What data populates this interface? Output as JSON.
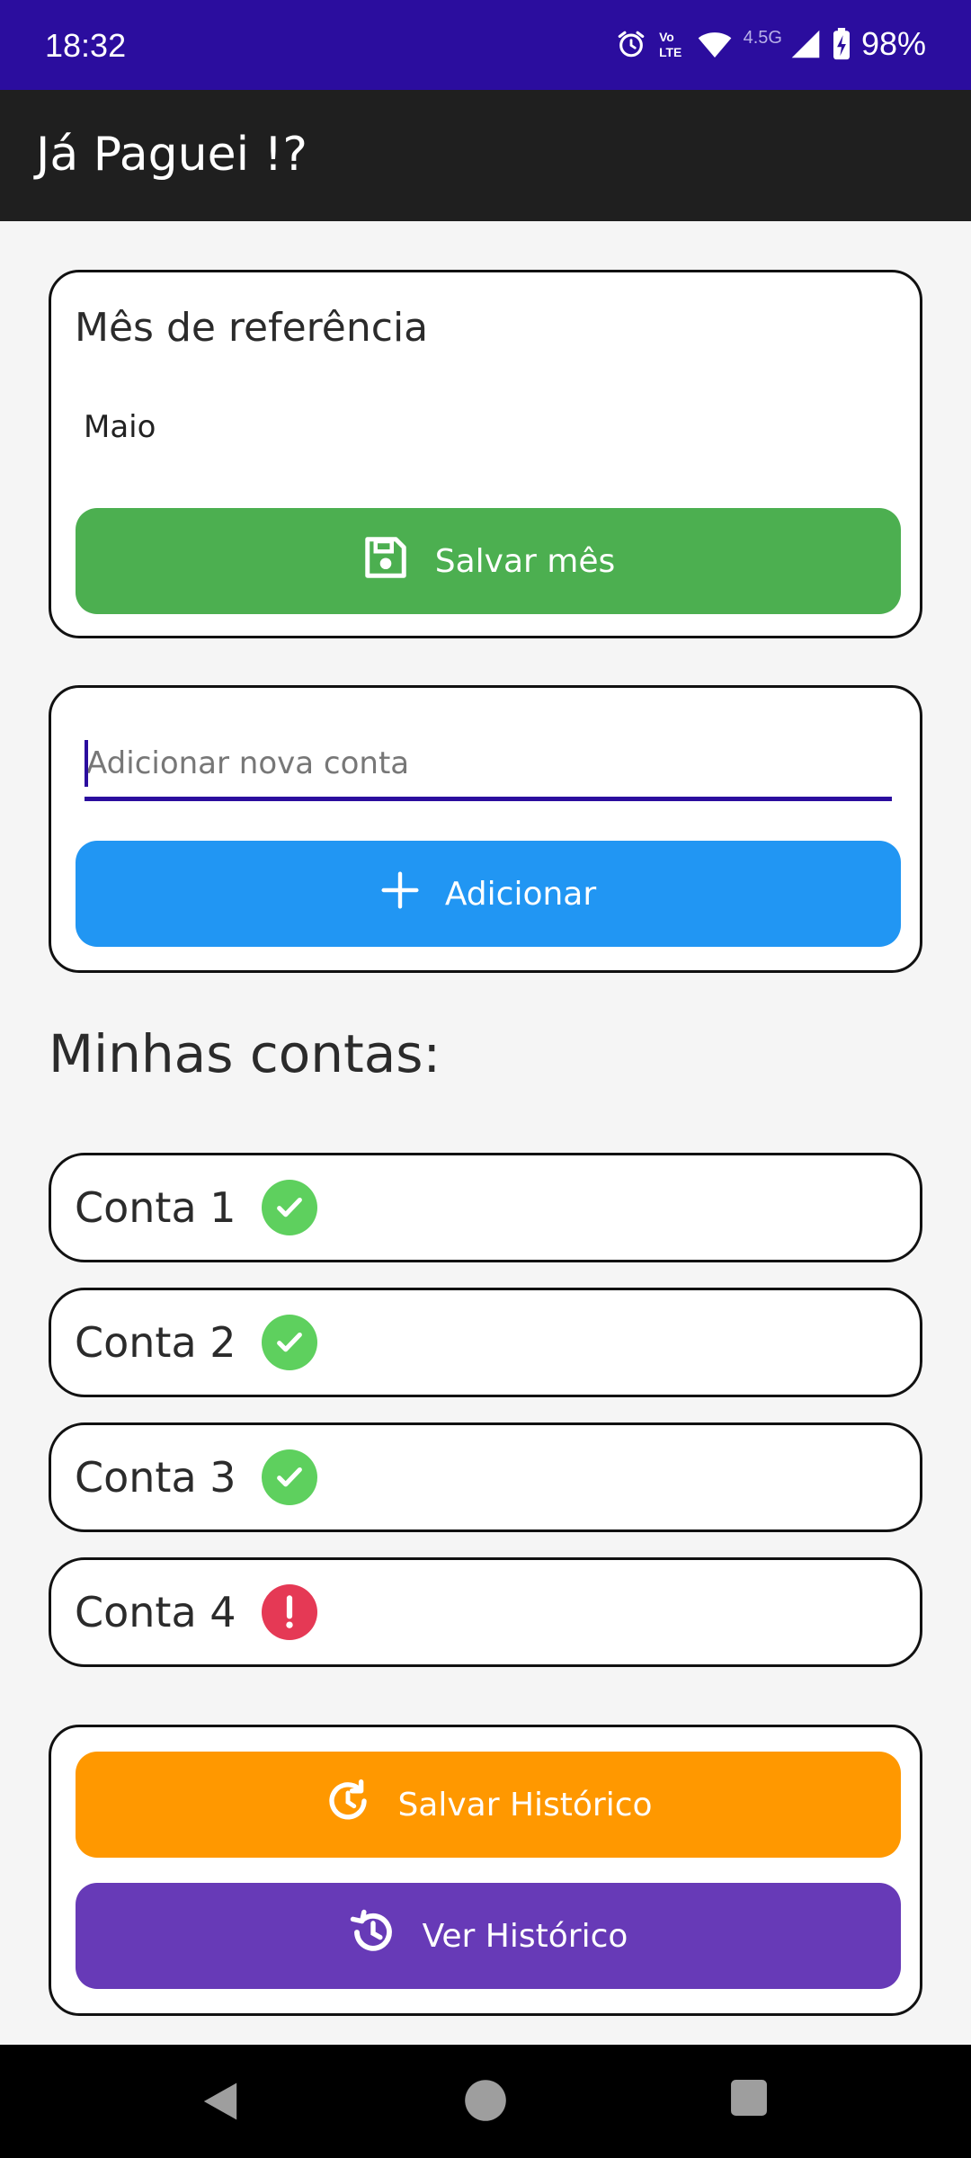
{
  "status_bar": {
    "time": "18:32",
    "network_label": "4.5G",
    "battery": "98%",
    "icons": [
      "alarm-icon",
      "volte-icon",
      "wifi-icon",
      "signal-icon",
      "battery-charging-icon"
    ]
  },
  "app_bar": {
    "title": "Já Paguei !?"
  },
  "month_card": {
    "label": "Mês de referência",
    "value": "Maio",
    "save_button": {
      "label": "Salvar mês",
      "icon": "save-icon"
    }
  },
  "add_card": {
    "input": {
      "placeholder": "Adicionar nova conta",
      "value": ""
    },
    "add_button": {
      "label": "Adicionar",
      "icon": "plus-icon"
    }
  },
  "accounts": {
    "title": "Minhas contas:",
    "items": [
      {
        "name": "Conta 1",
        "status": "paid",
        "icon": "check-circle-icon"
      },
      {
        "name": "Conta 2",
        "status": "paid",
        "icon": "check-circle-icon"
      },
      {
        "name": "Conta 3",
        "status": "paid",
        "icon": "check-circle-icon"
      },
      {
        "name": "Conta 4",
        "status": "unpaid",
        "icon": "exclamation-circle-icon"
      }
    ]
  },
  "history_card": {
    "save_button": {
      "label": "Salvar Histórico",
      "icon": "history-save-icon"
    },
    "view_button": {
      "label": "Ver Histórico",
      "icon": "history-icon"
    }
  },
  "colors": {
    "status_bar": "#2b0d9e",
    "app_bar": "#1f1f1f",
    "save_month": "#4caf50",
    "add": "#2196f3",
    "save_history": "#ff9800",
    "view_history": "#673ab7",
    "paid": "#5ed05e",
    "unpaid": "#e53955"
  }
}
